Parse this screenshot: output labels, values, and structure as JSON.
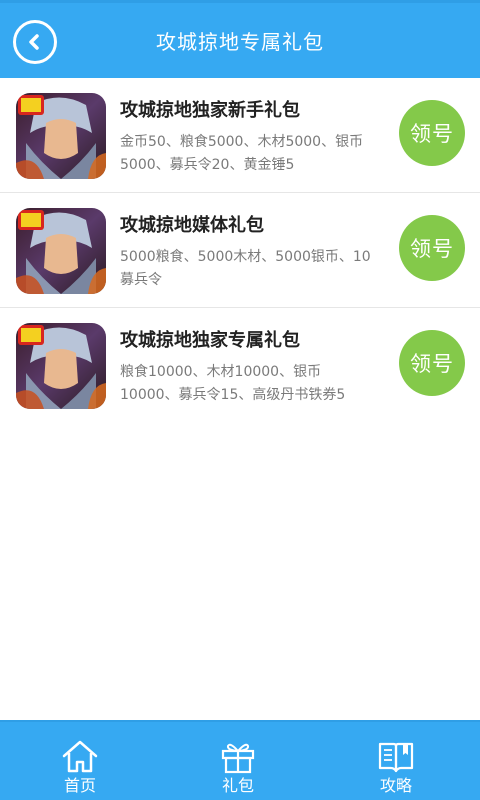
{
  "header": {
    "title": "攻城掠地专属礼包",
    "back_icon": "chevron-left-icon"
  },
  "gifts": [
    {
      "name": "攻城掠地独家新手礼包",
      "desc": "金币50、粮食5000、木材5000、银币5000、募兵令20、黄金锤5",
      "claim_label": "领号"
    },
    {
      "name": "攻城掠地媒体礼包",
      "desc": "5000粮食、5000木材、5000银币、10募兵令",
      "claim_label": "领号"
    },
    {
      "name": "攻城掠地独家专属礼包",
      "desc": "粮食10000、木材10000、银币10000、募兵令15、高级丹书铁券5",
      "claim_label": "领号"
    }
  ],
  "nav": {
    "items": [
      {
        "label": "首页",
        "icon": "home-icon"
      },
      {
        "label": "礼包",
        "icon": "gift-icon"
      },
      {
        "label": "攻略",
        "icon": "book-icon"
      }
    ]
  },
  "colors": {
    "primary": "#36a9f2",
    "claim_button": "#84c94a"
  }
}
